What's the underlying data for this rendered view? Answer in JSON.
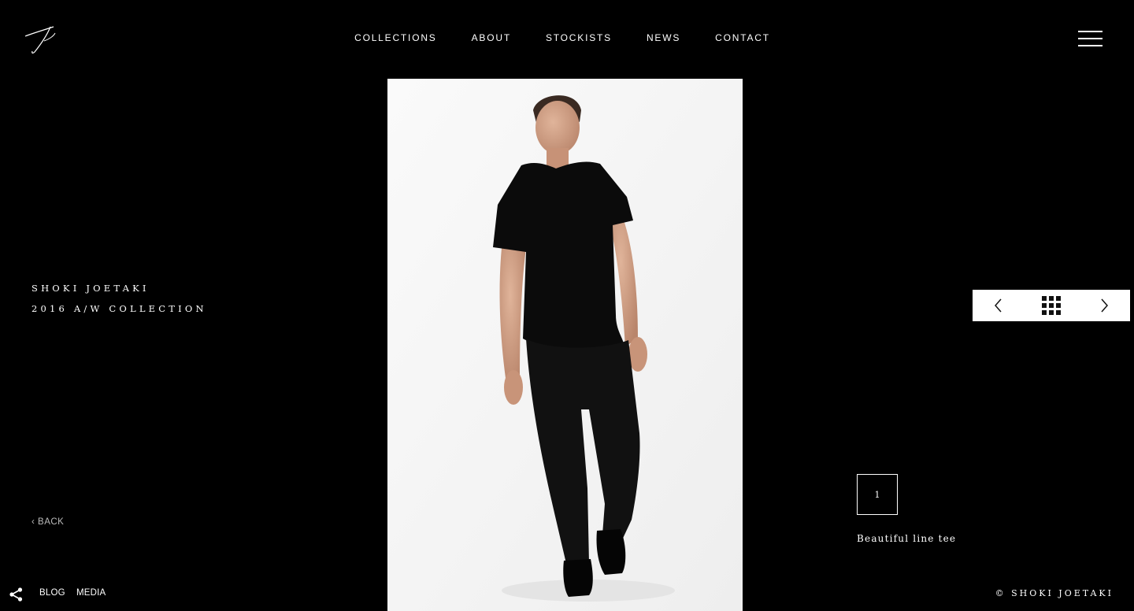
{
  "brand": {
    "logo_icon": "signature-logo-icon"
  },
  "nav": {
    "items": [
      {
        "label": "COLLECTIONS"
      },
      {
        "label": "ABOUT"
      },
      {
        "label": "STOCKISTS"
      },
      {
        "label": "NEWS"
      },
      {
        "label": "CONTACT"
      }
    ],
    "menu_icon": "hamburger-menu-icon"
  },
  "collection": {
    "designer": "SHOKI JOETAKI",
    "season": "2016 A/W COLLECTION"
  },
  "back": {
    "label": "‹ BACK"
  },
  "footer_links": {
    "share_icon": "share-icon",
    "blog": "BLOG",
    "media": "MEDIA"
  },
  "pager": {
    "prev_icon": "chevron-left-icon",
    "grid_icon": "grid-icon",
    "next_icon": "chevron-right-icon"
  },
  "slide": {
    "index": "1",
    "caption": "Beautiful line tee"
  },
  "copyright": "© SHOKI JOETAKI",
  "colors": {
    "background": "#000000",
    "text": "#ffffff",
    "pager_bg": "#ffffff",
    "photo_bg": "#f6f6f6"
  }
}
